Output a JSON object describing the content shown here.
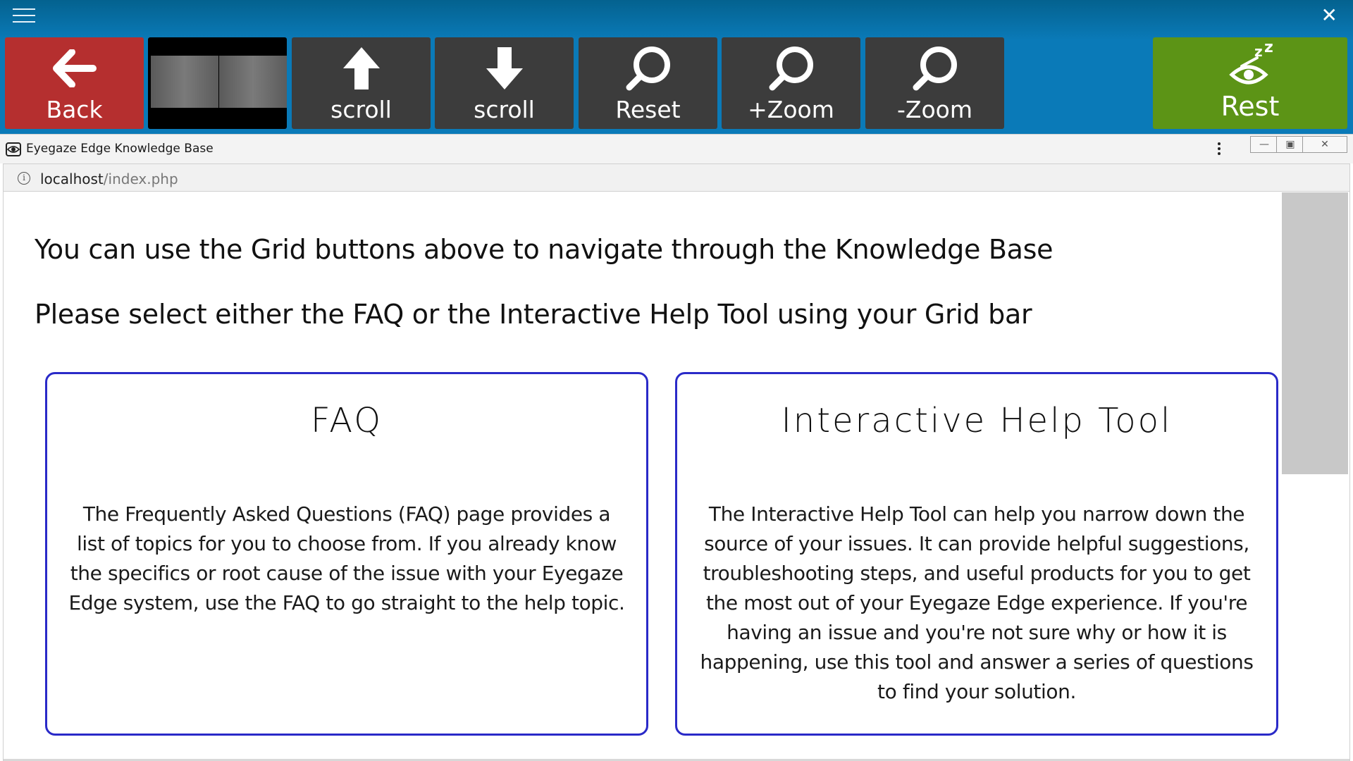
{
  "grid_bar": {
    "cells": {
      "back": "Back",
      "scroll_up": "scroll",
      "scroll_down": "scroll",
      "reset": "Reset",
      "zoom_in": "+Zoom",
      "zoom_out": "-Zoom",
      "rest": "Rest"
    },
    "icons": {
      "menu": "hamburger-icon",
      "close": "close-icon",
      "back": "arrow-left-icon",
      "scroll_up": "arrow-up-icon",
      "scroll_down": "arrow-down-icon",
      "reset": "magnifier-icon",
      "zoom_in": "magnifier-icon",
      "zoom_out": "magnifier-icon",
      "rest": "eye-sleep-icon"
    },
    "colors": {
      "bar": "#0a7ab8",
      "back": "#b52f2f",
      "default_cell": "#3c3c3c",
      "rest": "#5c9416"
    }
  },
  "browser": {
    "window_title": "Eyegaze Edge Knowledge Base",
    "url_host": "localhost",
    "url_path": "/index.php"
  },
  "page": {
    "intro_1": "You can use the Grid buttons above to navigate through the Knowledge Base",
    "intro_2": "Please select either the FAQ or the Interactive Help Tool using your Grid bar",
    "cards": [
      {
        "title": "FAQ",
        "description": "The Frequently Asked Questions (FAQ) page provides a list of topics for you to choose from. If you already know the specifics or root cause of the issue with your Eyegaze Edge system, use the FAQ to go straight to the help topic."
      },
      {
        "title": "Interactive Help Tool",
        "description": "The Interactive Help Tool can help you narrow down the source of your issues. It can provide helpful suggestions, troubleshooting steps, and useful products for you to get the most out of your Eyegaze Edge experience. If you're having an issue and you're not sure why or how it is happening, use this tool and answer a series of questions to find your solution."
      }
    ],
    "card_border_color": "#2a2ac8"
  }
}
